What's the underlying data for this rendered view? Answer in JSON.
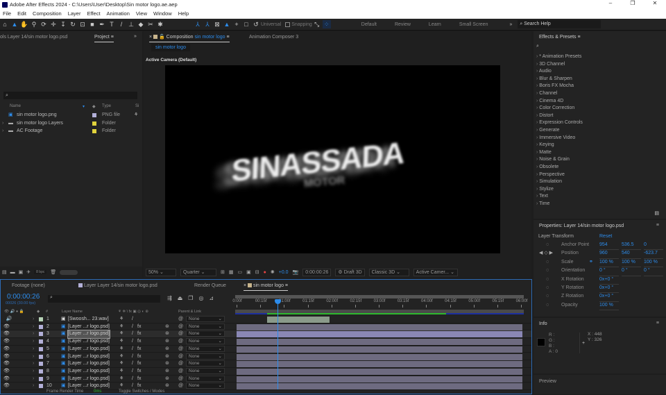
{
  "app": {
    "title": "Adobe After Effects 2024 - C:\\Users\\User\\Desktop\\Sin motor logo.ae.aep"
  },
  "menu": [
    "File",
    "Edit",
    "Composition",
    "Layer",
    "Effect",
    "Animation",
    "View",
    "Window",
    "Help"
  ],
  "toolbar": {
    "universal": "Universal",
    "snapping": "Snapping",
    "workspaces": [
      "Default",
      "Review",
      "Learn",
      "Small Screen"
    ],
    "search_placeholder": "Search Help"
  },
  "left_panel": {
    "tab_layer": "ols Layer 14/sin  motor logo.psd",
    "tab_project": "Project",
    "cols": {
      "name": "Name",
      "type": "Type",
      "size": "Si"
    },
    "items": [
      {
        "name": "sin  motor logo.png",
        "type": "PNG file",
        "color": "#b3b0d8"
      },
      {
        "name": "sin  motor logo Layers",
        "type": "Folder",
        "color": "#e0d23c"
      },
      {
        "name": "AC Footage",
        "type": "Folder",
        "color": "#e0d23c"
      }
    ],
    "bpc": "8 bpc"
  },
  "comp": {
    "tab_prefix": "Composition",
    "tab_name": "sin motor logo",
    "tab2": "Animation Composer 3",
    "breadcrumb": "sin motor logo",
    "camera_label": "Active Camera (Default)",
    "artwork_text": "SINASSADA",
    "artwork_sub": "MOTOR",
    "zoom": "50%",
    "resolution": "Quarter",
    "exposure": "+0.0",
    "timecode": "0:00:00:26",
    "draft": "Draft 3D",
    "renderer": "Classic 3D",
    "view": "Active Camer..."
  },
  "effects": {
    "title": "Effects & Presets",
    "items": [
      "* Animation Presets",
      "3D Channel",
      "Audio",
      "Blur & Sharpen",
      "Boris FX Mocha",
      "Channel",
      "Cinema 4D",
      "Color Correction",
      "Distort",
      "Expression Controls",
      "Generate",
      "Immersive Video",
      "Keying",
      "Matte",
      "Noise & Grain",
      "Obsolete",
      "Perspective",
      "Simulation",
      "Stylize",
      "Text",
      "Time"
    ]
  },
  "properties": {
    "title": "Properties: Layer 14/sin  motor logo.psd",
    "section": "Layer Transform",
    "reset": "Reset",
    "rows": [
      {
        "name": "Anchor Point",
        "values": [
          "954",
          "536.5",
          "0"
        ]
      },
      {
        "name": "Position",
        "values": [
          "960",
          "540",
          "-623.7"
        ]
      },
      {
        "name": "Scale",
        "values": [
          "100 %",
          "100 %",
          "100 %"
        ]
      },
      {
        "name": "Orientation",
        "values": [
          "0 °",
          "0 °",
          "0 °"
        ]
      },
      {
        "name": "X Rotation",
        "values": [
          "0x+0 °"
        ]
      },
      {
        "name": "Y Rotation",
        "values": [
          "0x+0 °"
        ]
      },
      {
        "name": "Z Rotation",
        "values": [
          "0x+0 °"
        ]
      },
      {
        "name": "Opacity",
        "values": [
          "100 %"
        ]
      }
    ]
  },
  "info": {
    "title": "Info",
    "r": "R :",
    "g": "G :",
    "b": "B :",
    "a": "A : 0",
    "x": "X : 448",
    "y": "Y : 326"
  },
  "preview": {
    "title": "Preview"
  },
  "timeline": {
    "tabs": [
      "Footage  (none)",
      "Layer  Layer 14/sin  motor logo.psd",
      "Render Queue",
      "sin motor logo"
    ],
    "timecode": "0:00:00:26",
    "fps": "00026 (30.00 fps)",
    "cols": {
      "num": "#",
      "name": "Layer Name",
      "parent": "Parent & Link"
    },
    "ruler": [
      "0:00f",
      "00:15f",
      "01:00f",
      "01:15f",
      "02:00f",
      "02:15f",
      "03:00f",
      "03:15f",
      "04:00f",
      "04:15f",
      "05:00f",
      "05:15f",
      "06:00f"
    ],
    "playhead_seconds": 0.87,
    "duration_seconds": 6,
    "layers": [
      {
        "num": "1",
        "name": "[Swoosh... 23.wav]",
        "parent": "None",
        "color": "#b7d3b7"
      },
      {
        "num": "2",
        "name": "[Layer ...r logo.psd]",
        "parent": "None",
        "color": "#b3b0d8"
      },
      {
        "num": "3",
        "name": "[Layer ...r logo.psd]",
        "parent": "None",
        "color": "#b3b0d8"
      },
      {
        "num": "4",
        "name": "[Layer ...r logo.psd]",
        "parent": "None",
        "color": "#b3b0d8"
      },
      {
        "num": "5",
        "name": "[Layer ...r logo.psd]",
        "parent": "None",
        "color": "#b3b0d8"
      },
      {
        "num": "6",
        "name": "[Layer ...r logo.psd]",
        "parent": "None",
        "color": "#b3b0d8"
      },
      {
        "num": "7",
        "name": "[Layer ...r logo.psd]",
        "parent": "None",
        "color": "#b3b0d8"
      },
      {
        "num": "8",
        "name": "[Layer ...r logo.psd]",
        "parent": "None",
        "color": "#b3b0d8"
      },
      {
        "num": "9",
        "name": "[Layer ...r logo.psd]",
        "parent": "None",
        "color": "#b3b0d8"
      },
      {
        "num": "10",
        "name": "[Layer ...r logo.psd]",
        "parent": "None",
        "color": "#b3b0d8"
      }
    ],
    "footer": {
      "render_label": "Frame Render Time",
      "render_value": "0ms",
      "toggle": "Toggle Switches / Modes"
    }
  }
}
